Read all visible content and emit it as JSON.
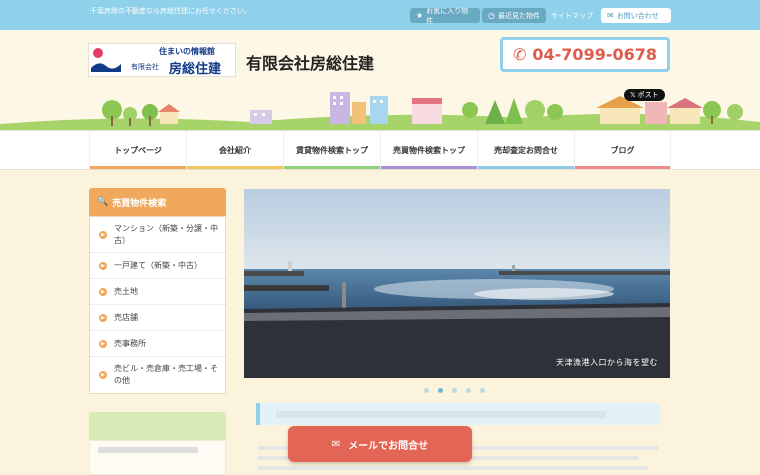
{
  "topbar": {
    "tagline": "千葉房総の不動産なら房総住建にお任せください。",
    "favorites": "お気に入り物件",
    "recent": "最近見た物件",
    "sitemap": "サイトマップ",
    "contact": "お問い合わせ"
  },
  "header": {
    "logo_top": "住まいの情報館",
    "logo_small": "有限会社",
    "logo_big": "房総住建",
    "company_name": "有限会社房総住建",
    "phone": "04-7099-0678",
    "x_post": "ポスト"
  },
  "nav": {
    "items": [
      {
        "label": "トップページ",
        "color": "#f0a85c"
      },
      {
        "label": "会社紹介",
        "color": "#f0c85c"
      },
      {
        "label": "賃貸物件検索トップ",
        "color": "#8ed17a"
      },
      {
        "label": "売買物件検索トップ",
        "color": "#a98fd6"
      },
      {
        "label": "売却査定お問合せ",
        "color": "#8fc9e6"
      },
      {
        "label": "ブログ",
        "color": "#f08a8a"
      }
    ]
  },
  "sidebar": {
    "title": "売買物件検索",
    "items": [
      {
        "label": "マンション（新築・分譲・中古）"
      },
      {
        "label": "一戸建て（新築・中古）"
      },
      {
        "label": "売土地"
      },
      {
        "label": "売店舗"
      },
      {
        "label": "売事務所"
      },
      {
        "label": "売ビル・売倉庫・売工場・その他"
      }
    ]
  },
  "slider": {
    "caption": "天津漁港入口から海を望む",
    "total_slides": 5,
    "active_slide": 2
  },
  "cta": {
    "mail_label": "メールでお問合せ"
  },
  "colors": {
    "accent_blue": "#8fd0ea",
    "accent_orange": "#f0a85c",
    "phone_red": "#e05b4c",
    "cta_red": "#e36556"
  }
}
